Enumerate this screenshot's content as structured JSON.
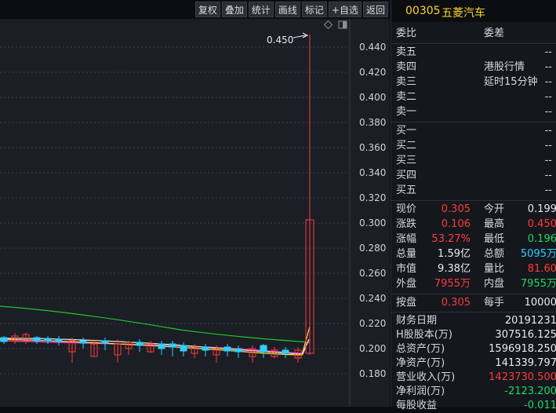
{
  "toolbar": {
    "buttons": [
      "复权",
      "叠加",
      "统计",
      "画线",
      "标记",
      "+自选",
      "返回"
    ]
  },
  "stock": {
    "code": "00305",
    "name": "五菱汽车"
  },
  "chart": {
    "max_label": "0.450",
    "y_ticks": [
      "0.440",
      "0.420",
      "0.400",
      "0.380",
      "0.360",
      "0.340",
      "0.320",
      "0.300",
      "0.280",
      "0.260",
      "0.240",
      "0.220",
      "0.200",
      "0.180"
    ]
  },
  "quote": {
    "weibi_label": "委比",
    "weicha_label": "委差",
    "sell": [
      {
        "label": "卖五",
        "price": "",
        "vol": "--"
      },
      {
        "label": "卖四",
        "price": "港股行情",
        "vol": "--"
      },
      {
        "label": "卖三",
        "price": "延时15分钟",
        "vol": "--"
      },
      {
        "label": "卖二",
        "price": "",
        "vol": "--"
      },
      {
        "label": "卖一",
        "price": "",
        "vol": "--"
      }
    ],
    "buy": [
      {
        "label": "买一",
        "vol": "--"
      },
      {
        "label": "买二",
        "vol": "--"
      },
      {
        "label": "买三",
        "vol": "--"
      },
      {
        "label": "买四",
        "vol": "--"
      },
      {
        "label": "买五",
        "vol": "--"
      }
    ],
    "stats": [
      {
        "l1": "现价",
        "v1": "0.305",
        "c1": "red",
        "l2": "今开",
        "v2": "0.199",
        "c2": "white"
      },
      {
        "l1": "涨跌",
        "v1": "0.106",
        "c1": "red",
        "l2": "最高",
        "v2": "0.450",
        "c2": "red"
      },
      {
        "l1": "涨幅",
        "v1": "53.27%",
        "c1": "red",
        "l2": "最低",
        "v2": "0.196",
        "c2": "green"
      },
      {
        "l1": "总量",
        "v1": "1.59亿",
        "c1": "white",
        "l2": "总额",
        "v2": "5095万",
        "c2": "cyan"
      },
      {
        "l1": "市值",
        "v1": "9.38亿",
        "c1": "white",
        "l2": "量比",
        "v2": "81.60",
        "c2": "red"
      },
      {
        "l1": "外盘",
        "v1": "7955万",
        "c1": "red",
        "l2": "内盘",
        "v2": "7955万",
        "c2": "green"
      }
    ],
    "lot": {
      "l1": "按盘",
      "v1": "0.305",
      "l2": "每手",
      "v2": "10000"
    },
    "finance": [
      {
        "label": "财务日期",
        "value": "20191231",
        "color": "white"
      },
      {
        "label": "H股股本(万)",
        "value": "307516.125",
        "color": "white"
      },
      {
        "label": "总资产(万)",
        "value": "1596918.250",
        "color": "white"
      },
      {
        "label": "净资产(万)",
        "value": "141339.797",
        "color": "white"
      },
      {
        "label": "营业收入(万)",
        "value": "1423730.500",
        "color": "red"
      },
      {
        "label": "净利润(万)",
        "value": "-2123.200",
        "color": "green"
      },
      {
        "label": "每股收益",
        "value": "-0.011",
        "color": "green"
      }
    ]
  }
}
